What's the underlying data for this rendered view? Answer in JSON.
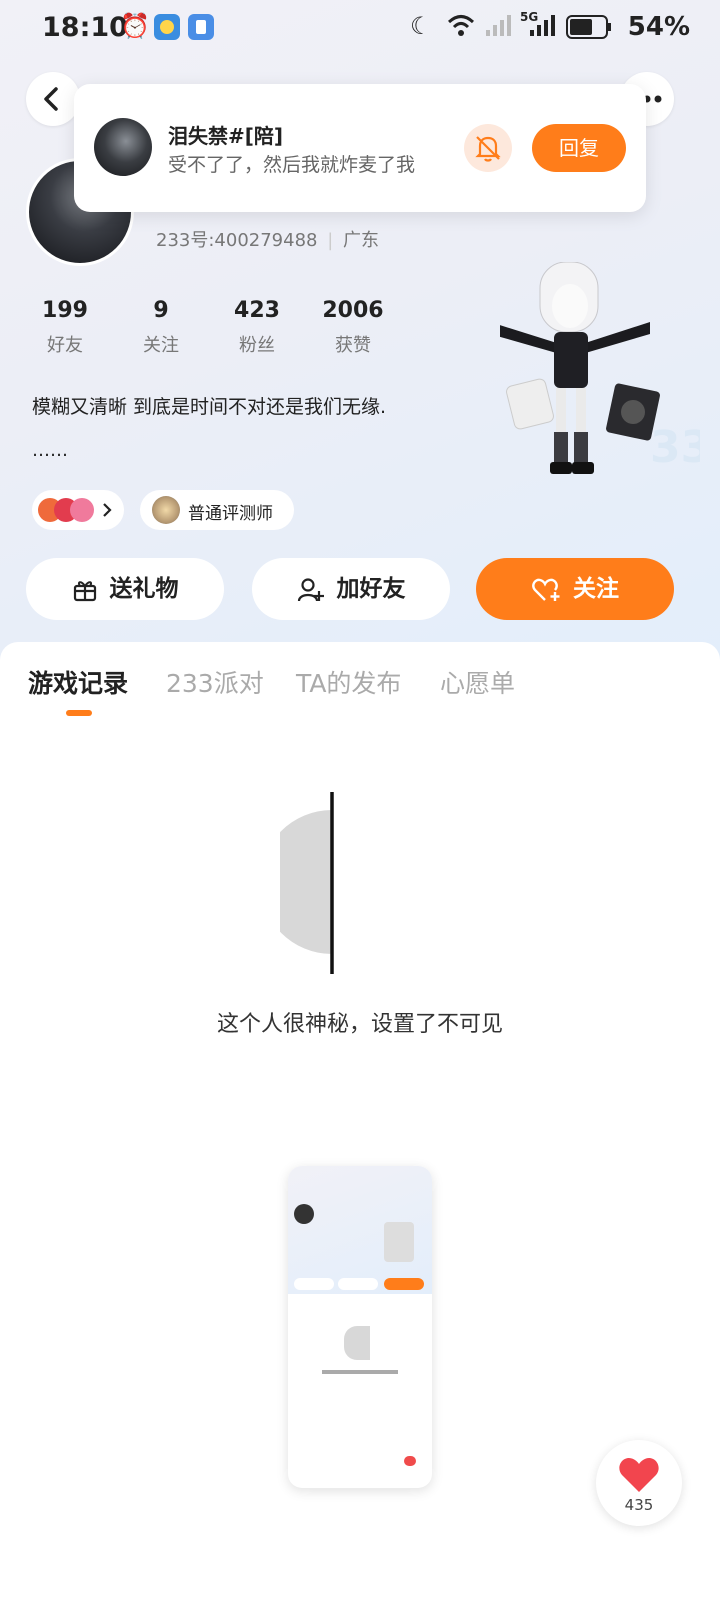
{
  "status_bar": {
    "time": "18:10",
    "battery": "54%",
    "network": "5G",
    "icons": [
      "alarm-icon",
      "weather-icon",
      "shield-app-icon",
      "moon-icon",
      "wifi-icon",
      "signal-icon",
      "battery-icon"
    ]
  },
  "notification": {
    "sender": "泪失禁#[陪]",
    "message": "受不了了，然后我就炸麦了我",
    "reply_label": "回复",
    "mute_icon": "bell-off-icon",
    "accent": "#ff7d1a"
  },
  "profile": {
    "id_text": "233号:400279488",
    "location": "广东",
    "stats": [
      {
        "value": "199",
        "label": "好友"
      },
      {
        "value": "9",
        "label": "关注"
      },
      {
        "value": "423",
        "label": "粉丝"
      },
      {
        "value": "2006",
        "label": "获赞"
      }
    ],
    "bio": "模糊又清晰 到底是时间不对还是我们无缘.",
    "bio_more": "……",
    "reviewer_label": "普通评测师"
  },
  "actions": {
    "gift": "送礼物",
    "add_friend": "加好友",
    "follow": "关注"
  },
  "tabs": [
    {
      "label": "游戏记录",
      "active": true
    },
    {
      "label": "233派对",
      "active": false
    },
    {
      "label": "TA的发布",
      "active": false
    },
    {
      "label": "心愿单",
      "active": false
    }
  ],
  "empty_state": {
    "text": "这个人很神秘，设置了不可见"
  },
  "like": {
    "count": "435"
  }
}
